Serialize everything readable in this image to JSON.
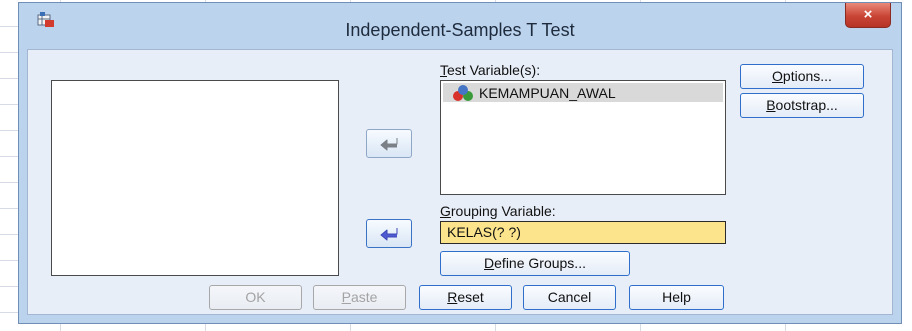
{
  "window": {
    "title": "Independent-Samples T Test",
    "close_glyph": "×",
    "app_icon": "spss-dialog-icon"
  },
  "source_list": {
    "items": []
  },
  "test_variables": {
    "label_first": "T",
    "label_rest": "est Variable(s):",
    "items": [
      {
        "name": "KEMAMPUAN_AWAL",
        "icon": "scale-variable-icon"
      }
    ]
  },
  "grouping_variable": {
    "label_first": "G",
    "label_rest": "rouping Variable:",
    "value": "KELAS(? ?)"
  },
  "buttons": {
    "options": {
      "first": "O",
      "rest": "ptions..."
    },
    "bootstrap": {
      "first": "B",
      "rest": "ootstrap..."
    },
    "define_groups": {
      "first": "D",
      "rest": "efine Groups..."
    },
    "ok": "OK",
    "paste": {
      "first": "P",
      "rest": "aste"
    },
    "reset": {
      "first": "R",
      "rest": "eset"
    },
    "cancel": "Cancel",
    "help": "Help"
  },
  "colors": {
    "dialog_frame": "#bcd3ee",
    "client_area": "#e8eef8",
    "grouping_field_highlight": "#fbe48c",
    "close_button": "#c94536",
    "button_border": "#2f6fcb"
  }
}
